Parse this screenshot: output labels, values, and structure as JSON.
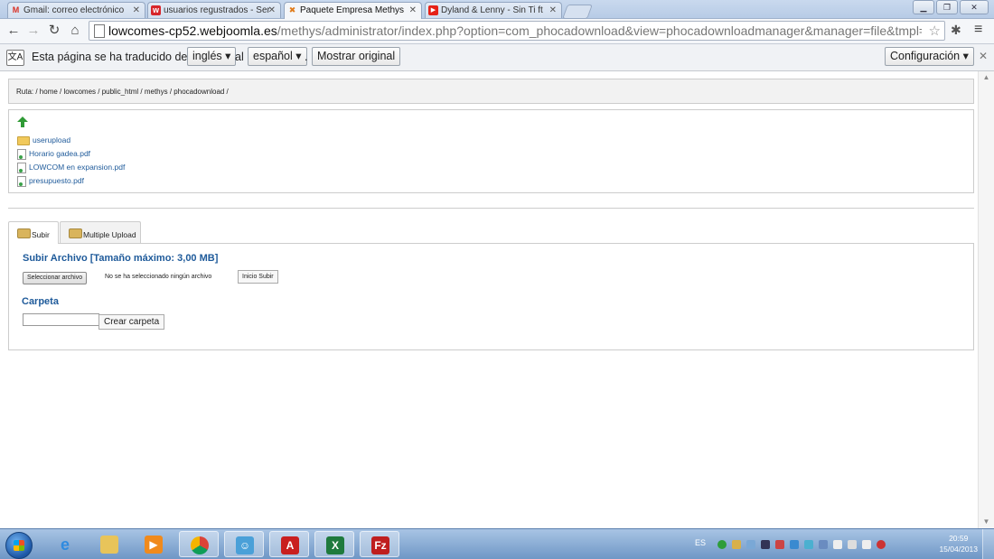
{
  "browser": {
    "tabs": [
      {
        "title": "Gmail: correo electrónico",
        "icon": "gmail-icon"
      },
      {
        "title": "usuarios regustrados - Ser",
        "icon": "site-icon"
      },
      {
        "title": "Paquete Empresa Methys",
        "icon": "joomla-icon"
      },
      {
        "title": "Dyland & Lenny - Sin Ti ft",
        "icon": "youtube-icon"
      }
    ],
    "url_host": "lowcomes-cp52.webjoomla.es",
    "url_path": "/methys/administrator/index.php?option=com_phocadownload&view=phocadownloadmanager&manager=file&tmpl=component&folder"
  },
  "translate_bar": {
    "text_before": "Esta página se ha traducido del",
    "from_lang": "inglés",
    "text_mid": "al",
    "to_lang": "español",
    "text_dot": ".",
    "show_original": "Mostrar original",
    "settings": "Configuración"
  },
  "page": {
    "breadcrumb": "Ruta: / home / lowcomes / public_html / methys / phocadownload /",
    "items": [
      {
        "name": "userupload",
        "kind": "folder"
      },
      {
        "name": "Horario gadea.pdf",
        "kind": "file"
      },
      {
        "name": "LOWCOM en expansion.pdf",
        "kind": "file"
      },
      {
        "name": "presupuesto.pdf",
        "kind": "file"
      }
    ],
    "tabs": [
      {
        "label": "Subir"
      },
      {
        "label": "Multiple Upload"
      }
    ],
    "upload_title": "Subir Archivo [Tamaño máximo: 3,00 MB]",
    "select_file_button": "Seleccionar archivo",
    "no_file_text": "No se ha seleccionado ningún archivo",
    "start_upload_button": "Inicio Subir",
    "folder_title": "Carpeta",
    "create_folder_button": "Crear carpeta"
  },
  "taskbar": {
    "lang": "ES",
    "time": "20:59",
    "date": "15/04/2013"
  }
}
